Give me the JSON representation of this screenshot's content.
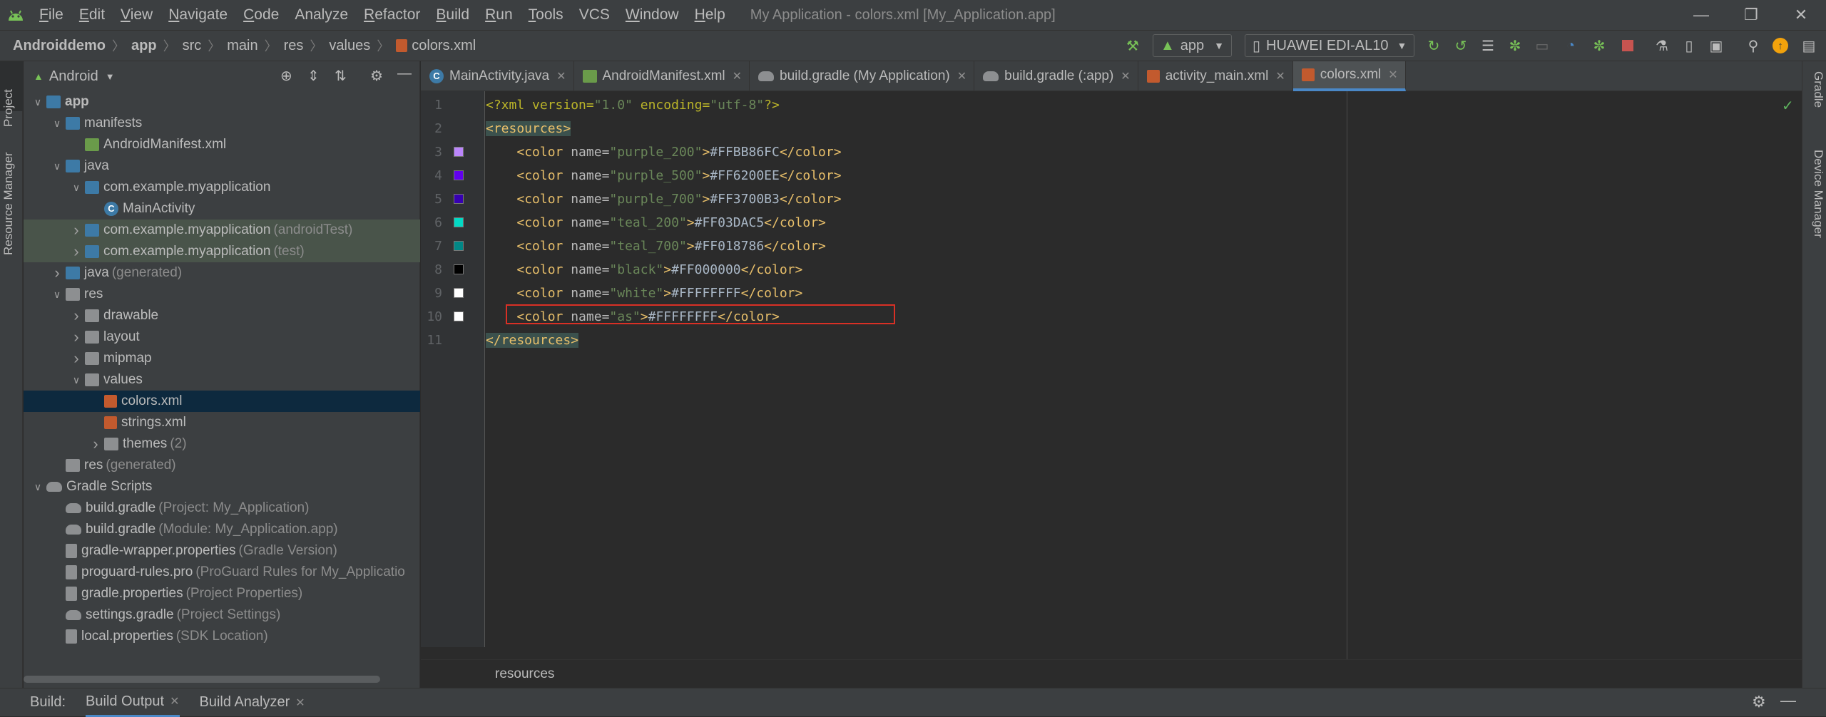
{
  "menubar": {
    "items": [
      {
        "label": "File",
        "u": "F",
        "rest": "ile"
      },
      {
        "label": "Edit",
        "u": "E",
        "rest": "dit"
      },
      {
        "label": "View",
        "u": "V",
        "rest": "iew"
      },
      {
        "label": "Navigate",
        "u": "N",
        "rest": "avigate"
      },
      {
        "label": "Code",
        "u": "C",
        "rest": "ode"
      },
      {
        "label": "Analyze",
        "u": "",
        "rest": "Analyze"
      },
      {
        "label": "Refactor",
        "u": "R",
        "rest": "efactor"
      },
      {
        "label": "Build",
        "u": "B",
        "rest": "uild"
      },
      {
        "label": "Run",
        "u": "R",
        "rest": "un"
      },
      {
        "label": "Tools",
        "u": "T",
        "rest": "ools"
      },
      {
        "label": "VCS",
        "u": "",
        "rest": "VCS"
      },
      {
        "label": "Window",
        "u": "W",
        "rest": "indow"
      },
      {
        "label": "Help",
        "u": "H",
        "rest": "elp"
      }
    ],
    "window_title": "My Application - colors.xml [My_Application.app]"
  },
  "breadcrumbs": [
    "Androiddemo",
    "app",
    "src",
    "main",
    "res",
    "values",
    "colors.xml"
  ],
  "toolbar": {
    "run_config": "app",
    "device": "HUAWEI EDI-AL10"
  },
  "left_strip": {
    "project_tab": "Project",
    "resource_manager_tab": "Resource Manager"
  },
  "right_strip": {
    "gradle_tab": "Gradle",
    "device_manager_tab": "Device Manager"
  },
  "project_panel": {
    "view_mode": "Android",
    "tree": [
      {
        "label": "app",
        "sub": "",
        "depth": 0,
        "arrow": "v",
        "icon": "folder",
        "bold": true
      },
      {
        "label": "manifests",
        "sub": "",
        "depth": 1,
        "arrow": "v",
        "icon": "folder"
      },
      {
        "label": "AndroidManifest.xml",
        "sub": "",
        "depth": 2,
        "arrow": "",
        "icon": "manifest"
      },
      {
        "label": "java",
        "sub": "",
        "depth": 1,
        "arrow": "v",
        "icon": "folder"
      },
      {
        "label": "com.example.myapplication",
        "sub": "",
        "depth": 2,
        "arrow": "v",
        "icon": "pkg"
      },
      {
        "label": "MainActivity",
        "sub": "",
        "depth": 3,
        "arrow": "",
        "icon": "class"
      },
      {
        "label": "com.example.myapplication",
        "sub": "(androidTest)",
        "depth": 2,
        "arrow": ">",
        "icon": "pkg",
        "test": true
      },
      {
        "label": "com.example.myapplication",
        "sub": "(test)",
        "depth": 2,
        "arrow": ">",
        "icon": "pkg",
        "test": true
      },
      {
        "label": "java",
        "sub": "(generated)",
        "depth": 1,
        "arrow": ">",
        "icon": "folder"
      },
      {
        "label": "res",
        "sub": "",
        "depth": 1,
        "arrow": "v",
        "icon": "folder-grey"
      },
      {
        "label": "drawable",
        "sub": "",
        "depth": 2,
        "arrow": ">",
        "icon": "folder-grey"
      },
      {
        "label": "layout",
        "sub": "",
        "depth": 2,
        "arrow": ">",
        "icon": "folder-grey"
      },
      {
        "label": "mipmap",
        "sub": "",
        "depth": 2,
        "arrow": ">",
        "icon": "folder-grey"
      },
      {
        "label": "values",
        "sub": "",
        "depth": 2,
        "arrow": "v",
        "icon": "folder-grey"
      },
      {
        "label": "colors.xml",
        "sub": "",
        "depth": 3,
        "arrow": "",
        "icon": "xml",
        "selected": true
      },
      {
        "label": "strings.xml",
        "sub": "",
        "depth": 3,
        "arrow": "",
        "icon": "xml"
      },
      {
        "label": "themes",
        "sub": "(2)",
        "depth": 3,
        "arrow": ">",
        "icon": "folder-grey"
      },
      {
        "label": "res",
        "sub": "(generated)",
        "depth": 1,
        "arrow": "",
        "icon": "folder-grey"
      },
      {
        "label": "Gradle Scripts",
        "sub": "",
        "depth": 0,
        "arrow": "v",
        "icon": "gradle"
      },
      {
        "label": "build.gradle",
        "sub": "(Project: My_Application)",
        "depth": 1,
        "arrow": "",
        "icon": "gradle"
      },
      {
        "label": "build.gradle",
        "sub": "(Module: My_Application.app)",
        "depth": 1,
        "arrow": "",
        "icon": "gradle"
      },
      {
        "label": "gradle-wrapper.properties",
        "sub": "(Gradle Version)",
        "depth": 1,
        "arrow": "",
        "icon": "prop"
      },
      {
        "label": "proguard-rules.pro",
        "sub": "(ProGuard Rules for My_Applicatio",
        "depth": 1,
        "arrow": "",
        "icon": "prop"
      },
      {
        "label": "gradle.properties",
        "sub": "(Project Properties)",
        "depth": 1,
        "arrow": "",
        "icon": "prop"
      },
      {
        "label": "settings.gradle",
        "sub": "(Project Settings)",
        "depth": 1,
        "arrow": "",
        "icon": "gradle"
      },
      {
        "label": "local.properties",
        "sub": "(SDK Location)",
        "depth": 1,
        "arrow": "",
        "icon": "prop"
      }
    ]
  },
  "editor_tabs": [
    {
      "label": "MainActivity.java",
      "icon": "class",
      "active": false
    },
    {
      "label": "AndroidManifest.xml",
      "icon": "manifest",
      "active": false
    },
    {
      "label": "build.gradle (My Application)",
      "icon": "gradle",
      "active": false
    },
    {
      "label": "build.gradle (:app)",
      "icon": "gradle",
      "active": false
    },
    {
      "label": "activity_main.xml",
      "icon": "xml",
      "active": false
    },
    {
      "label": "colors.xml",
      "icon": "xml",
      "active": true
    }
  ],
  "code_lines": [
    {
      "n": "1",
      "swatch": "",
      "parts": [
        [
          "pi",
          "<?xml version="
        ],
        [
          "val",
          "\"1.0\""
        ],
        [
          "pi",
          " encoding="
        ],
        [
          "val",
          "\"utf-8\""
        ],
        [
          "pi",
          "?>"
        ]
      ]
    },
    {
      "n": "2",
      "swatch": "",
      "parts": [
        [
          "tag rtag",
          "<resources>"
        ]
      ]
    },
    {
      "n": "3",
      "swatch": "#BB86FC",
      "parts": [
        [
          "txt",
          "    "
        ],
        [
          "tag",
          "<color "
        ],
        [
          "attr",
          "name="
        ],
        [
          "val",
          "\"purple_200\""
        ],
        [
          "tag",
          ">"
        ],
        [
          "txt",
          "#FFBB86FC"
        ],
        [
          "tag",
          "</color>"
        ]
      ]
    },
    {
      "n": "4",
      "swatch": "#6200EE",
      "parts": [
        [
          "txt",
          "    "
        ],
        [
          "tag",
          "<color "
        ],
        [
          "attr",
          "name="
        ],
        [
          "val",
          "\"purple_500\""
        ],
        [
          "tag",
          ">"
        ],
        [
          "txt",
          "#FF6200EE"
        ],
        [
          "tag",
          "</color>"
        ]
      ]
    },
    {
      "n": "5",
      "swatch": "#3700B3",
      "parts": [
        [
          "txt",
          "    "
        ],
        [
          "tag",
          "<color "
        ],
        [
          "attr",
          "name="
        ],
        [
          "val",
          "\"purple_700\""
        ],
        [
          "tag",
          ">"
        ],
        [
          "txt",
          "#FF3700B3"
        ],
        [
          "tag",
          "</color>"
        ]
      ]
    },
    {
      "n": "6",
      "swatch": "#03DAC5",
      "parts": [
        [
          "txt",
          "    "
        ],
        [
          "tag",
          "<color "
        ],
        [
          "attr",
          "name="
        ],
        [
          "val",
          "\"teal_200\""
        ],
        [
          "tag",
          ">"
        ],
        [
          "txt",
          "#FF03DAC5"
        ],
        [
          "tag",
          "</color>"
        ]
      ]
    },
    {
      "n": "7",
      "swatch": "#018786",
      "parts": [
        [
          "txt",
          "    "
        ],
        [
          "tag",
          "<color "
        ],
        [
          "attr",
          "name="
        ],
        [
          "val",
          "\"teal_700\""
        ],
        [
          "tag",
          ">"
        ],
        [
          "txt",
          "#FF018786"
        ],
        [
          "tag",
          "</color>"
        ]
      ]
    },
    {
      "n": "8",
      "swatch": "#000000",
      "parts": [
        [
          "txt",
          "    "
        ],
        [
          "tag",
          "<color "
        ],
        [
          "attr",
          "name="
        ],
        [
          "val",
          "\"black\""
        ],
        [
          "tag",
          ">"
        ],
        [
          "txt",
          "#FF000000"
        ],
        [
          "tag",
          "</color>"
        ]
      ]
    },
    {
      "n": "9",
      "swatch": "#FFFFFF",
      "parts": [
        [
          "txt",
          "    "
        ],
        [
          "tag",
          "<color "
        ],
        [
          "attr",
          "name="
        ],
        [
          "val",
          "\"white\""
        ],
        [
          "tag",
          ">"
        ],
        [
          "txt",
          "#FFFFFFFF"
        ],
        [
          "tag",
          "</color>"
        ]
      ]
    },
    {
      "n": "10",
      "swatch": "#FFFFFF",
      "parts": [
        [
          "txt",
          "    "
        ],
        [
          "tag",
          "<color "
        ],
        [
          "attr",
          "name="
        ],
        [
          "val",
          "\"as\""
        ],
        [
          "tag",
          ">"
        ],
        [
          "txt",
          "#FFFFFFFF"
        ],
        [
          "tag",
          "</color>"
        ]
      ]
    },
    {
      "n": "11",
      "swatch": "",
      "parts": [
        [
          "tag rtag",
          "</resources>"
        ]
      ]
    }
  ],
  "editor_breadcrumb": "resources",
  "bottom_bar": {
    "build_label": "Build:",
    "tabs": [
      "Build Output",
      "Build Analyzer"
    ]
  },
  "colors": {
    "accent": "#4a88c7",
    "highlight_box": "#d93025",
    "android_green": "#78c257"
  }
}
